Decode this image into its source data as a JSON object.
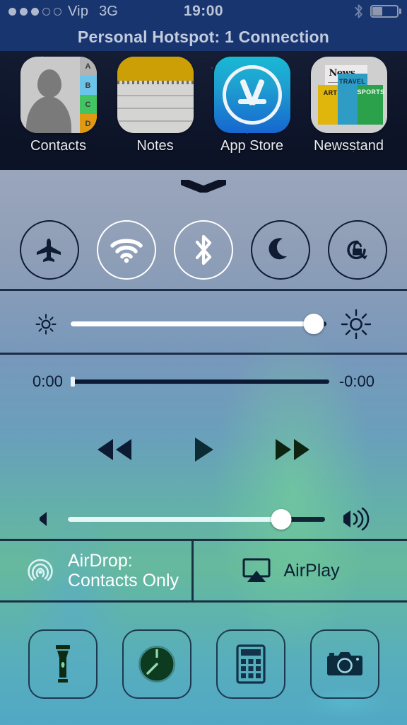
{
  "status_bar": {
    "signal_dots_filled": 3,
    "signal_dots_total": 5,
    "carrier": "Vip",
    "network": "3G",
    "time": "19:00",
    "bluetooth_icon": "bluetooth-icon",
    "battery_icon": "battery-icon",
    "battery_level_percent": 40,
    "background_color": "#193570",
    "text_color": "#b9c4d8"
  },
  "hotspot_banner": {
    "text": "Personal Hotspot: 1 Connection"
  },
  "home_screen": {
    "apps": [
      {
        "label": "Contacts",
        "icon": "contacts-icon",
        "tabs": [
          "A",
          "B",
          "C",
          "D"
        ]
      },
      {
        "label": "Notes",
        "icon": "notes-icon"
      },
      {
        "label": "App Store",
        "icon": "app-store-icon"
      },
      {
        "label": "Newsstand",
        "icon": "newsstand-icon",
        "covers": [
          "News",
          "ART",
          "TRAVEL",
          "SPORTS"
        ]
      }
    ]
  },
  "control_center": {
    "grabber_icon": "chevron-grabber-icon",
    "toggles": [
      {
        "name": "airplane-mode",
        "icon": "airplane-icon",
        "state": "off"
      },
      {
        "name": "wifi",
        "icon": "wifi-icon",
        "state": "on"
      },
      {
        "name": "bluetooth",
        "icon": "bluetooth-icon",
        "state": "on"
      },
      {
        "name": "do-not-disturb",
        "icon": "moon-icon",
        "state": "off"
      },
      {
        "name": "rotation-lock",
        "icon": "rotation-lock-icon",
        "state": "off"
      }
    ],
    "brightness": {
      "value_percent": 95,
      "low_icon": "brightness-low-icon",
      "high_icon": "brightness-high-icon"
    },
    "media": {
      "elapsed_time": "0:00",
      "remaining_time": "-0:00",
      "progress_percent": 0,
      "previous_icon": "rewind-icon",
      "play_icon": "play-icon",
      "next_icon": "fast-forward-icon",
      "volume": {
        "value_percent": 83,
        "low_icon": "volume-low-icon",
        "high_icon": "volume-high-icon"
      }
    },
    "airdrop": {
      "icon": "airdrop-icon",
      "label_line1": "AirDrop:",
      "label_line2": "Contacts Only",
      "state": "on"
    },
    "airplay": {
      "icon": "airplay-icon",
      "label": "AirPlay",
      "state": "off"
    },
    "shortcuts": [
      {
        "name": "flashlight",
        "icon": "flashlight-icon"
      },
      {
        "name": "timer",
        "icon": "timer-icon"
      },
      {
        "name": "calculator",
        "icon": "calculator-icon"
      },
      {
        "name": "camera",
        "icon": "camera-icon"
      }
    ]
  },
  "colors": {
    "status_bar_bg": "#193570",
    "panel_dark_ink": "#0c1a33",
    "active_white": "#ffffff"
  }
}
